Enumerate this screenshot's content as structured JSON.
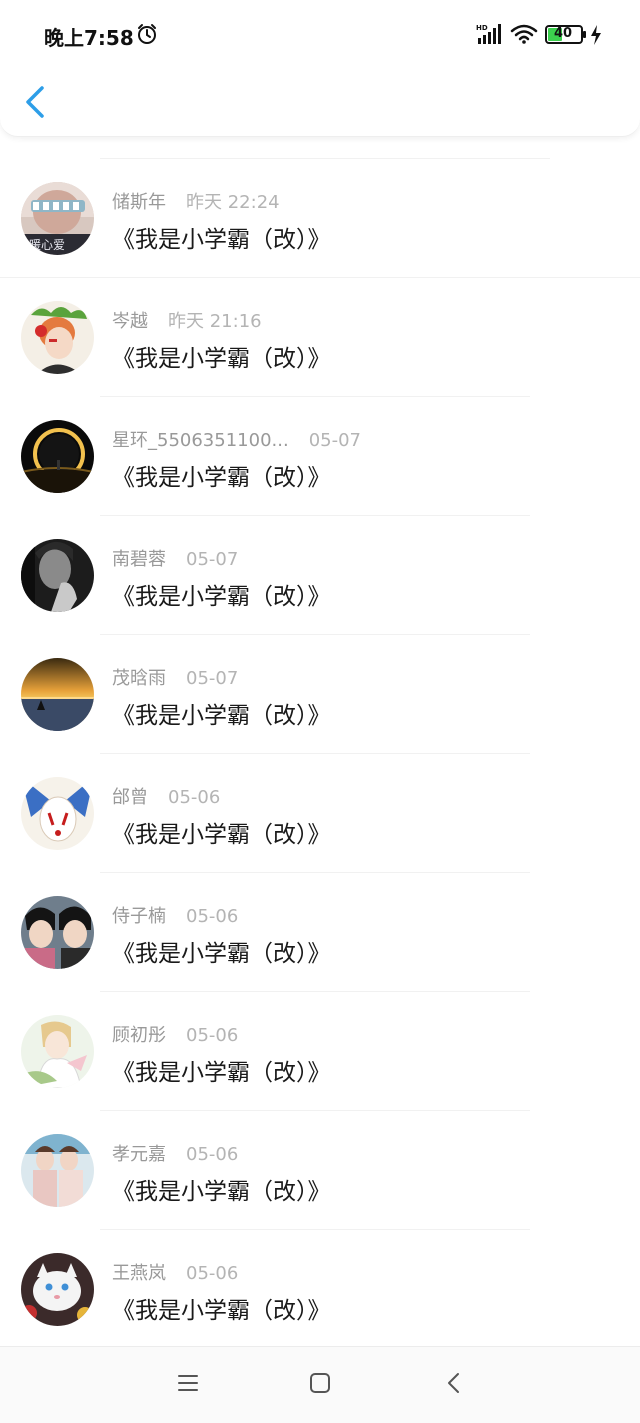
{
  "status": {
    "time": "晚上7:58",
    "battery": "40",
    "icons": [
      "alarm-icon",
      "signal-icon",
      "wifi-icon",
      "battery-icon",
      "charging-icon"
    ]
  },
  "header": {
    "back_icon": "chevron-left-icon",
    "accent": "#2d9ee8"
  },
  "comments": [
    {
      "name": "储斯年",
      "time": "昨天 22:24",
      "title": "《我是小学霸（改）》"
    },
    {
      "name": "岑越",
      "time": "昨天 21:16",
      "title": "《我是小学霸（改）》"
    },
    {
      "name": "星环_5506351100...",
      "time": "05-07",
      "title": "《我是小学霸（改）》"
    },
    {
      "name": "南碧蓉",
      "time": "05-07",
      "title": "《我是小学霸（改）》"
    },
    {
      "name": "茂晗雨",
      "time": "05-07",
      "title": "《我是小学霸（改）》"
    },
    {
      "name": "邰曾",
      "time": "05-06",
      "title": "《我是小学霸（改）》"
    },
    {
      "name": "侍子楠",
      "time": "05-06",
      "title": "《我是小学霸（改）》"
    },
    {
      "name": "顾初彤",
      "time": "05-06",
      "title": "《我是小学霸（改）》"
    },
    {
      "name": "孝元嘉",
      "time": "05-06",
      "title": "《我是小学霸（改）》"
    },
    {
      "name": "王燕岚",
      "time": "05-06",
      "title": "《我是小学霸（改）》"
    }
  ],
  "navbar": {
    "icons": [
      "menu-icon",
      "home-icon",
      "back-icon"
    ]
  }
}
